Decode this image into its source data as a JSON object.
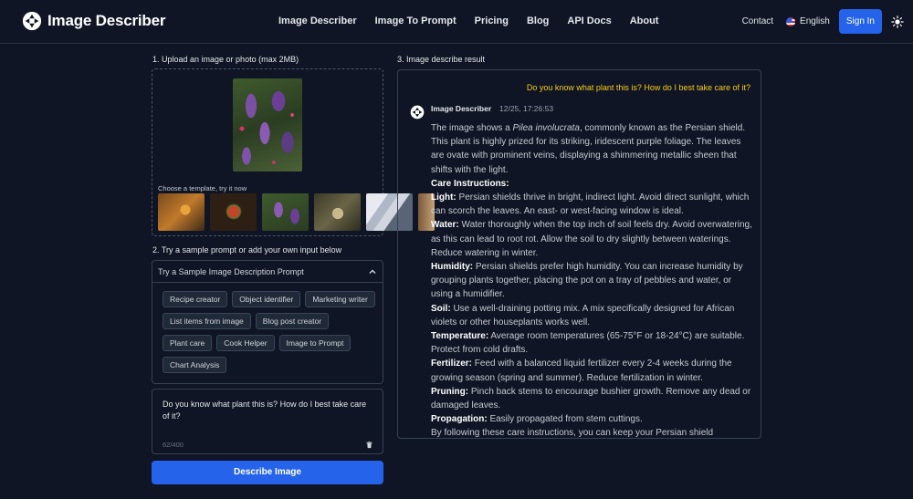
{
  "header": {
    "brand": "Image Describer",
    "nav": [
      "Image Describer",
      "Image To Prompt",
      "Pricing",
      "Blog",
      "API Docs",
      "About"
    ],
    "contact": "Contact",
    "language": "English",
    "sign_in": "Sign In"
  },
  "upload": {
    "label": "1. Upload an image or photo (max 2MB)",
    "template_label": "Choose a template, try it now"
  },
  "prompt": {
    "label": "2. Try a sample prompt or add your own input below",
    "dropdown_label": "Try a Sample Image Description Prompt",
    "tags": [
      "Recipe creator",
      "Object identifier",
      "Marketing writer",
      "List items from image",
      "Blog post creator",
      "Plant care",
      "Cook Helper",
      "Image to Prompt",
      "Chart Analysis"
    ],
    "input_value": "Do you know what plant this is? How do I best take care of it?",
    "counter": "62/400",
    "button": "Describe Image"
  },
  "result": {
    "label": "3. Image describe result",
    "question": "Do you know what plant this is? How do I best take care of it?",
    "bot_name": "Image Describer",
    "timestamp": "12/25, 17:26:53",
    "intro_a": "The image shows a ",
    "intro_italic": "Pilea involucrata",
    "intro_b": ", commonly known as the Persian shield. This plant is highly prized for its striking, iridescent purple foliage. The leaves are ovate with prominent veins, displaying a shimmering metallic sheen that shifts with the light.",
    "care_heading": "Care Instructions:",
    "light_label": "Light:",
    "light_text": " Persian shields thrive in bright, indirect light. Avoid direct sunlight, which can scorch the leaves. An east- or west-facing window is ideal.",
    "water_label": "Water:",
    "water_text": " Water thoroughly when the top inch of soil feels dry. Avoid overwatering, as this can lead to root rot. Allow the soil to dry slightly between waterings. Reduce watering in winter.",
    "humidity_label": "Humidity:",
    "humidity_text": " Persian shields prefer high humidity. You can increase humidity by grouping plants together, placing the pot on a tray of pebbles and water, or using a humidifier.",
    "soil_label": "Soil:",
    "soil_text": " Use a well-draining potting mix. A mix specifically designed for African violets or other houseplants works well.",
    "temp_label": "Temperature:",
    "temp_text": " Average room temperatures (65-75°F or 18-24°C) are suitable. Protect from cold drafts.",
    "fert_label": "Fertilizer:",
    "fert_text": " Feed with a balanced liquid fertilizer every 2-4 weeks during the growing season (spring and summer). Reduce fertilization in winter.",
    "prune_label": "Pruning:",
    "prune_text": " Pinch back stems to encourage bushier growth. Remove any dead or damaged leaves.",
    "prop_label": "Propagation:",
    "prop_text": " Easily propagated from stem cuttings.",
    "closing": "By following these care instructions, you can keep your Persian shield"
  }
}
